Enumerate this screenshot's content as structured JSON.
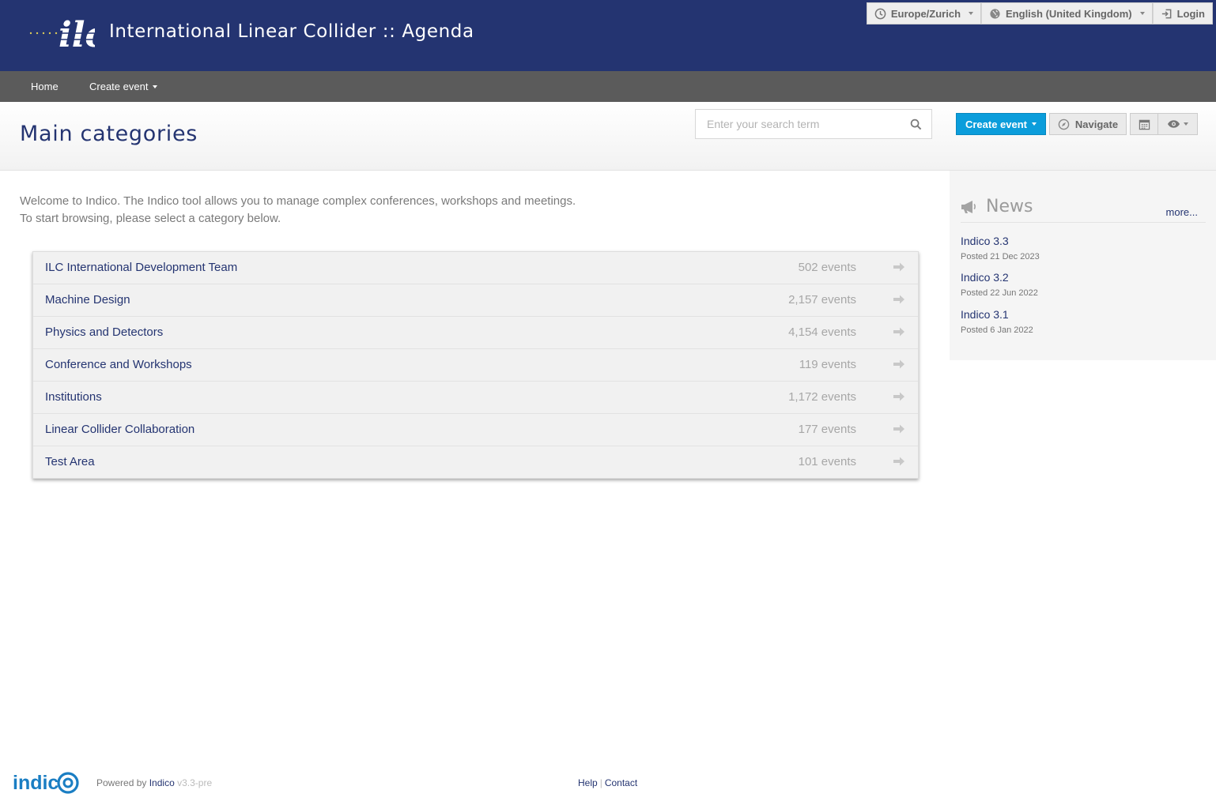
{
  "header": {
    "site_title": "International Linear Collider :: Agenda",
    "timezone": "Europe/Zurich",
    "language": "English (United Kingdom)",
    "login": "Login"
  },
  "nav": {
    "home": "Home",
    "create_event": "Create event"
  },
  "page": {
    "title": "Main categories",
    "search_placeholder": "Enter your search term",
    "create_event_button": "Create event",
    "navigate_button": "Navigate"
  },
  "welcome": {
    "line1": "Welcome to Indico. The Indico tool allows you to manage complex conferences, workshops and meetings.",
    "line2": "To start browsing, please select a category below."
  },
  "categories": [
    {
      "name": "ILC International Development Team",
      "count": "502 events"
    },
    {
      "name": "Machine Design",
      "count": "2,157 events"
    },
    {
      "name": "Physics and Detectors",
      "count": "4,154 events"
    },
    {
      "name": "Conference and Workshops",
      "count": "119 events"
    },
    {
      "name": "Institutions",
      "count": "1,172 events"
    },
    {
      "name": "Linear Collider Collaboration",
      "count": "177 events"
    },
    {
      "name": "Test Area",
      "count": "101 events"
    }
  ],
  "news": {
    "title": "News",
    "more": "more...",
    "items": [
      {
        "title": "Indico 3.3",
        "date": "Posted 21 Dec 2023"
      },
      {
        "title": "Indico 3.2",
        "date": "Posted 22 Jun 2022"
      },
      {
        "title": "Indico 3.1",
        "date": "Posted 6 Jan 2022"
      }
    ]
  },
  "footer": {
    "powered_by": "Powered by",
    "indico_link": "Indico",
    "version": "v3.3-pre",
    "help": "Help",
    "separator": "|",
    "contact": "Contact"
  },
  "colors": {
    "brand_blue": "#243471",
    "accent_blue": "#0b9ddb",
    "nav_gray": "#5b5b5b"
  }
}
